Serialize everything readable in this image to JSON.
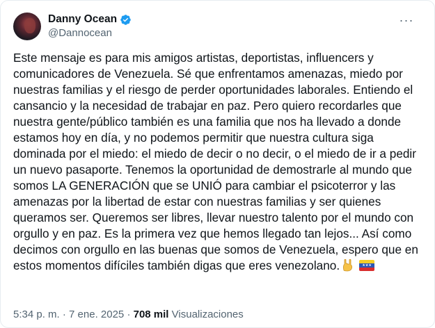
{
  "user": {
    "display_name": "Danny Ocean",
    "handle": "@Dannocean",
    "verified_icon": "verified-badge-icon",
    "verified_color": "#1d9bf0"
  },
  "more_icon": "more-dots-icon",
  "more_label": "···",
  "tweet_text": "Este mensaje es para mis amigos artistas, deportistas, influencers y comunicadores de Venezuela. Sé que enfrentamos amenazas, miedo por nuestras familias y el riesgo de perder oportunidades laborales. Entiendo el cansancio y la necesidad de trabajar en paz. Pero quiero recordarles que nuestra gente/público también es una familia que nos ha llevado a donde estamos hoy en día, y no podemos permitir que nuestra cultura siga dominada por el miedo: el miedo de decir o no decir, o el miedo de ir a pedir un nuevo pasaporte. Tenemos la oportunidad de demostrarle al mundo que somos LA GENERACIÓN que se UNIÓ para cambiar el psicoterror y las amenazas por la libertad de estar con nuestras familias y ser quienes queramos ser. Queremos ser libres, llevar nuestro talento por el mundo con orgullo y en paz. Es la primera vez que hemos llegado tan lejos... Así como decimos con orgullo en las buenas que somos de Venezuela, espero que en estos momentos difíciles también digas que eres venezolano.",
  "emojis": [
    "rock-hand-emoji",
    "venezuela-flag-emoji"
  ],
  "meta": {
    "timestamp": "5:34 p. m. · 7 ene. 2025 ·",
    "views_count": "708 mil",
    "views_label": "Visualizaciones"
  }
}
